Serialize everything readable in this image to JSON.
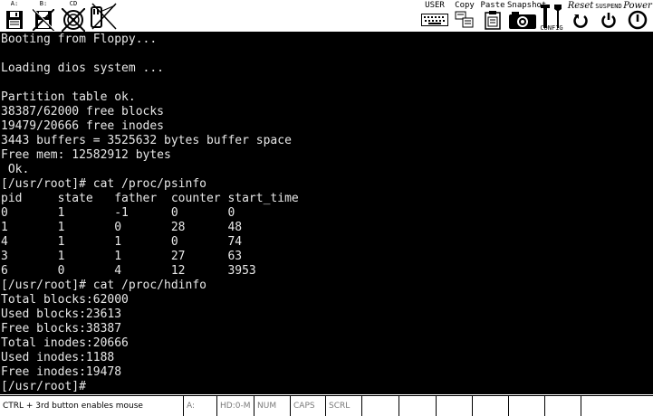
{
  "toolbar": {
    "floppy_a_label": "A:",
    "floppy_b_label": "B:",
    "cdrom_label": "CD",
    "user_label": "USER",
    "copy_label": "Copy",
    "paste_label": "Paste",
    "snapshot_label": "Snapshot",
    "config_label": "CONFIG",
    "reset_label": "Reset",
    "suspend_label": "SUSPEND",
    "power_label": "Power"
  },
  "terminal": {
    "lines": [
      "Booting from Floppy...",
      "",
      "Loading dios system ...",
      "",
      "Partition table ok.",
      "38387/62000 free blocks",
      "19479/20666 free inodes",
      "3443 buffers = 3525632 bytes buffer space",
      "Free mem: 12582912 bytes",
      " Ok.",
      "[/usr/root]# cat /proc/psinfo",
      "pid     state   father  counter start_time",
      "0       1       -1      0       0",
      "1       1       0       28      48",
      "4       1       1       0       74",
      "3       1       1       27      63",
      "6       0       4       12      3953",
      "[/usr/root]# cat /proc/hdinfo",
      "Total blocks:62000",
      "Used blocks:23613",
      "Free blocks:38387",
      "Total inodes:20666",
      "Used inodes:1188",
      "Free inodes:19478",
      "[/usr/root]#"
    ]
  },
  "statusbar": {
    "hint": "CTRL + 3rd button enables mouse",
    "drive_a": "A:",
    "hd": "HD:0-M",
    "num": "NUM",
    "caps": "CAPS",
    "scrl": "SCRL"
  }
}
